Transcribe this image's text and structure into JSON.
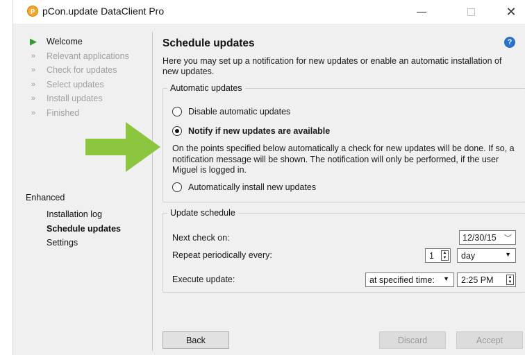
{
  "window": {
    "title": "pCon.update DataClient Pro",
    "app_icon": "pcon-logo-icon",
    "controls": {
      "minimize": "—",
      "maximize": "☐",
      "close": "✕"
    }
  },
  "sidebar": {
    "steps": [
      {
        "label": "Welcome",
        "icon": "arrow-right-icon",
        "state": "current"
      },
      {
        "label": "Relevant applications",
        "icon": "double-arrow-icon",
        "state": "pending"
      },
      {
        "label": "Check for updates",
        "icon": "double-arrow-icon",
        "state": "pending"
      },
      {
        "label": "Select updates",
        "icon": "double-arrow-icon",
        "state": "pending"
      },
      {
        "label": "Install updates",
        "icon": "double-arrow-icon",
        "state": "pending"
      },
      {
        "label": "Finished",
        "icon": "double-arrow-icon",
        "state": "pending"
      }
    ],
    "enhanced": {
      "title": "Enhanced",
      "items": [
        {
          "label": "Installation log"
        },
        {
          "label": "Schedule updates",
          "active": true
        },
        {
          "label": "Settings"
        }
      ]
    }
  },
  "main": {
    "title": "Schedule updates",
    "help_glyph": "?",
    "intro": "Here you may set up a notification for new updates or enable an automatic installation of new updates.",
    "automatic_updates": {
      "legend": "Automatic updates",
      "options": [
        {
          "label": "Disable automatic updates",
          "selected": false
        },
        {
          "label": "Notify if new updates are available",
          "selected": true
        },
        {
          "label": "Automatically install new updates",
          "selected": false
        }
      ],
      "notify_description": "On the points specified below automatically a check for new updates will be done. If so, a notification message will be shown. The notification will only be performed, if the user Miguel is logged in."
    },
    "update_schedule": {
      "legend": "Update schedule",
      "next_check_label": "Next check on:",
      "next_check_value": "12/30/15",
      "repeat_label": "Repeat periodically every:",
      "repeat_count": "1",
      "repeat_unit": "day",
      "execute_label": "Execute update:",
      "execute_mode": "at specified time:",
      "execute_time": "2:25 PM"
    }
  },
  "footer": {
    "back": "Back",
    "discard": "Discard",
    "accept": "Accept"
  },
  "colors": {
    "accent_arrow": "#8cc63f",
    "current_step": "#2e9e2e",
    "help_blue": "#2a6fc9"
  }
}
